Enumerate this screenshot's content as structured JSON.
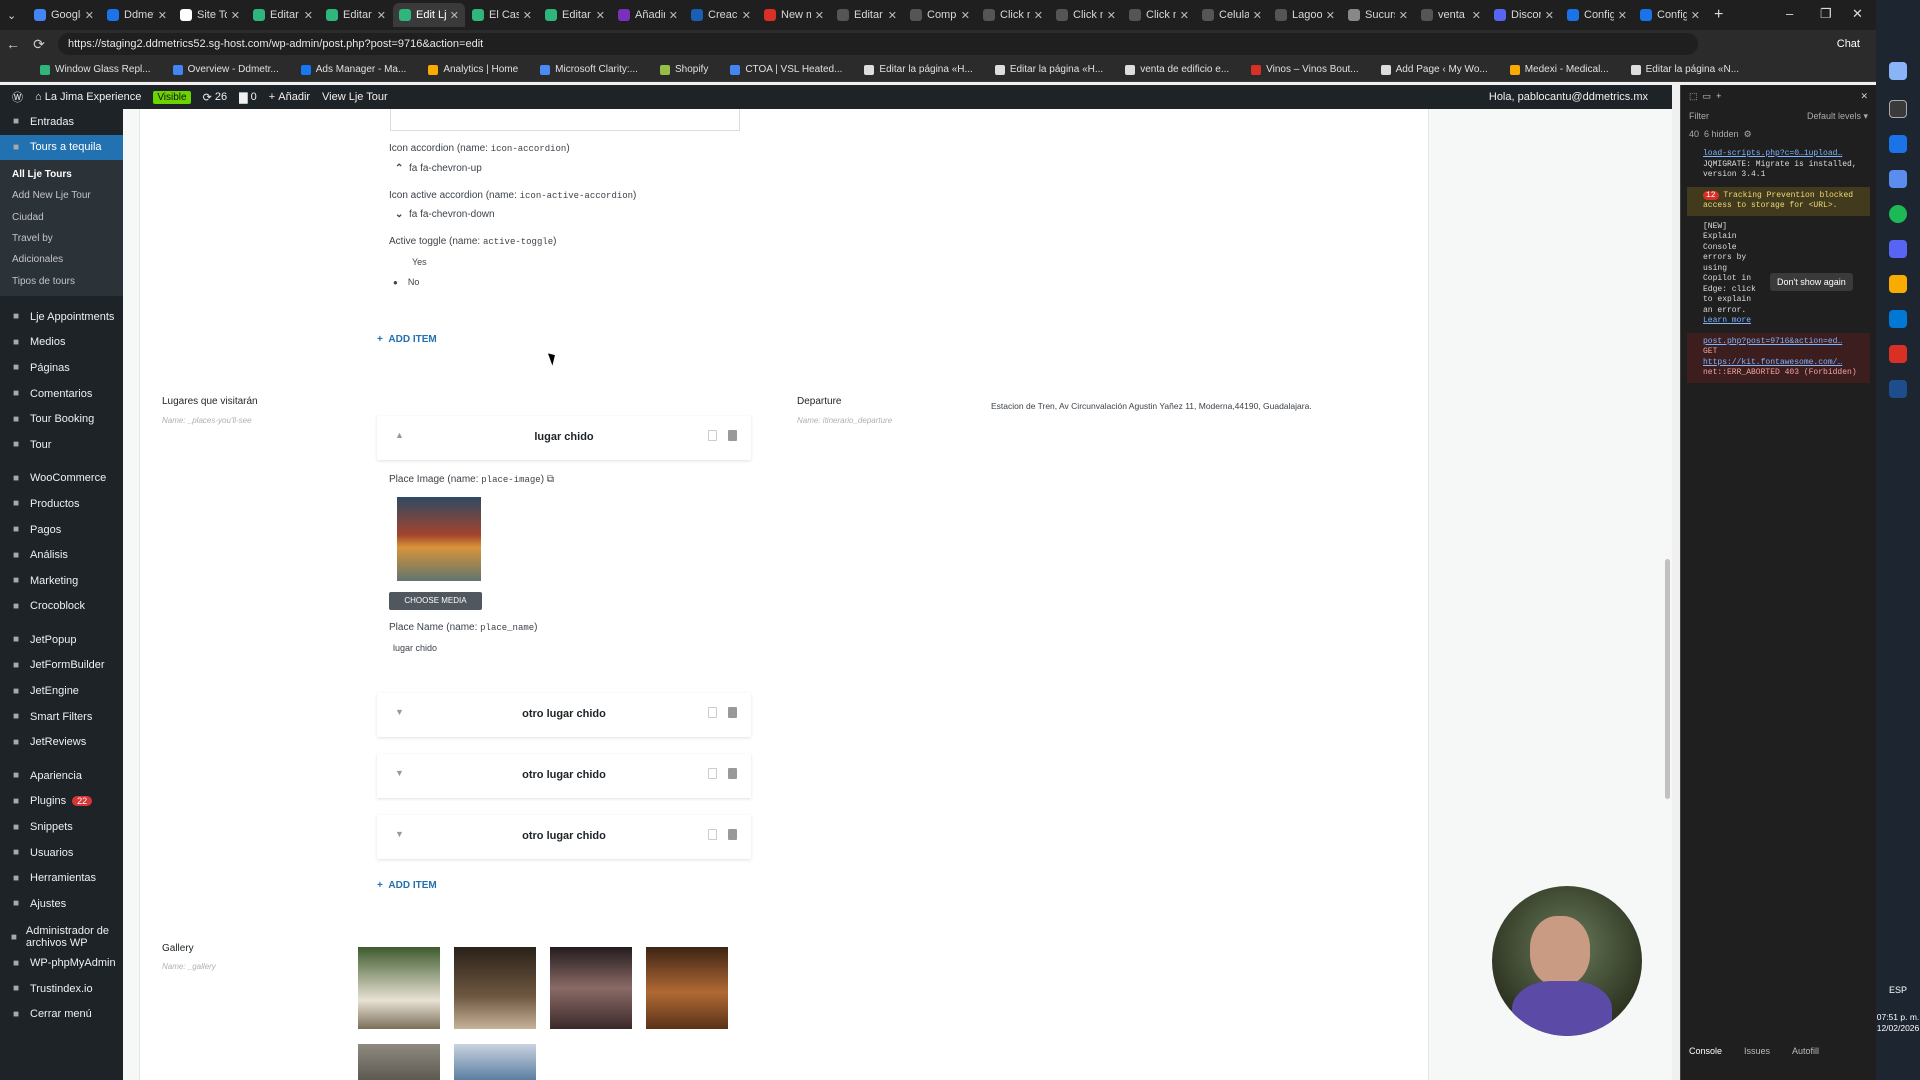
{
  "browser": {
    "tabs": [
      {
        "label": "Google",
        "color": "#4285f4"
      },
      {
        "label": "Ddmetr",
        "color": "#1a73e8"
      },
      {
        "label": "Site Tour",
        "color": "#ffffff"
      },
      {
        "label": "Editar e",
        "color": "#2eb67d"
      },
      {
        "label": "Editar e",
        "color": "#2eb67d"
      },
      {
        "label": "Edit Lje",
        "color": "#2eb67d",
        "active": true
      },
      {
        "label": "El Castil",
        "color": "#2eb67d"
      },
      {
        "label": "Editar e",
        "color": "#2eb67d"
      },
      {
        "label": "Añadir",
        "color": "#7b2fbf"
      },
      {
        "label": "Creació",
        "color": "#1a5fb4"
      },
      {
        "label": "New m",
        "color": "#d93025"
      },
      {
        "label": "Editar l",
        "color": "#555555"
      },
      {
        "label": "Compr",
        "color": "#555555"
      },
      {
        "label": "Click n",
        "color": "#555555"
      },
      {
        "label": "Click n",
        "color": "#555555"
      },
      {
        "label": "Click n",
        "color": "#555555"
      },
      {
        "label": "Celular",
        "color": "#555555"
      },
      {
        "label": "Lagoon",
        "color": "#555555"
      },
      {
        "label": "Sucurs",
        "color": "#888888"
      },
      {
        "label": "venta d",
        "color": "#555555"
      },
      {
        "label": "Discord",
        "color": "#5865f2"
      },
      {
        "label": "Config",
        "color": "#1a73e8"
      },
      {
        "label": "Config",
        "color": "#1a73e8"
      }
    ],
    "url": "https://staging2.ddmetrics52.sg-host.com/wp-admin/post.php?post=9716&action=edit",
    "chat_label": "Chat",
    "bookmarks": [
      {
        "label": "Window Glass Repl...",
        "color": "#2eb67d"
      },
      {
        "label": "Overview - Ddmetr...",
        "color": "#4285f4"
      },
      {
        "label": "Ads Manager - Ma...",
        "color": "#1877f2"
      },
      {
        "label": "Analytics | Home",
        "color": "#f9ab00"
      },
      {
        "label": "Microsoft Clarity:...",
        "color": "#4a8af4"
      },
      {
        "label": "Shopify",
        "color": "#95bf47"
      },
      {
        "label": "CTOA | VSL Heated...",
        "color": "#4285f4"
      },
      {
        "label": "Editar la página «H...",
        "color": "#dddddd"
      },
      {
        "label": "Editar la página «H...",
        "color": "#dddddd"
      },
      {
        "label": "venta de edificio e...",
        "color": "#dddddd"
      },
      {
        "label": "Vinos – Vinos Bout...",
        "color": "#d93025"
      },
      {
        "label": "Add Page ‹ My Wo...",
        "color": "#dddddd"
      },
      {
        "label": "Medexi - Medical...",
        "color": "#f9ab00"
      },
      {
        "label": "Editar la página «N...",
        "color": "#dddddd"
      }
    ]
  },
  "wpbar": {
    "site": "La Jima Experience",
    "visible": "Visible",
    "updates": "26",
    "comments": "0",
    "add": "Añadir",
    "view": "View Lje Tour",
    "howdy": "Hola, pablocantu@ddmetrics.mx"
  },
  "sidebar": {
    "top": [
      {
        "label": "Entradas",
        "icon": "pin-icon"
      },
      {
        "label": "Tours a tequila",
        "icon": "pin-icon",
        "current": true
      }
    ],
    "submenu": [
      "All Lje Tours",
      "Add New Lje Tour",
      "Ciudad",
      "Travel by",
      "Adicionales",
      "Tipos de tours"
    ],
    "group1": [
      {
        "label": "Lje Appointments"
      },
      {
        "label": "Medios"
      },
      {
        "label": "Páginas"
      },
      {
        "label": "Comentarios"
      },
      {
        "label": "Tour Booking"
      },
      {
        "label": "Tour"
      }
    ],
    "group2": [
      {
        "label": "WooCommerce"
      },
      {
        "label": "Productos"
      },
      {
        "label": "Pagos"
      },
      {
        "label": "Análisis"
      },
      {
        "label": "Marketing"
      },
      {
        "label": "Crocoblock"
      }
    ],
    "group3": [
      {
        "label": "JetPopup"
      },
      {
        "label": "JetFormBuilder"
      },
      {
        "label": "JetEngine"
      },
      {
        "label": "Smart Filters"
      },
      {
        "label": "JetReviews"
      }
    ],
    "group4": [
      {
        "label": "Apariencia"
      },
      {
        "label": "Plugins",
        "badge": "22"
      },
      {
        "label": "Snippets"
      },
      {
        "label": "Usuarios"
      },
      {
        "label": "Herramientas"
      },
      {
        "label": "Ajustes"
      }
    ],
    "group5": [
      {
        "label": "Administrador de archivos WP"
      },
      {
        "label": "WP-phpMyAdmin"
      },
      {
        "label": "Trustindex.io"
      },
      {
        "label": "Cerrar menú"
      }
    ]
  },
  "editor": {
    "icon_accordion_label": "Icon accordion (name: ",
    "icon_accordion_name": "icon-accordion",
    "icon_accordion_value": "fa fa-chevron-up",
    "icon_active_label": "Icon active accordion (name: ",
    "icon_active_name": "icon-active-accordion",
    "icon_active_value": "fa fa-chevron-down",
    "active_toggle_label": "Active toggle (name: ",
    "active_toggle_name": "active-toggle",
    "yes": "Yes",
    "no": "No",
    "add_item": "ADD ITEM",
    "places_title": "Lugares que visitarán",
    "places_name": "Name: _places-you'll-see",
    "departure_title": "Departure",
    "departure_name": "Name: itinerario_departure",
    "departure_value": "Estacion de Tren, Av Circunvalación Agustin Yañez 11, Moderna,44190, Guadalajara.",
    "repeater_items": [
      "lugar chido",
      "otro lugar chido",
      "otro lugar chido",
      "otro lugar chido"
    ],
    "place_image_label": "Place Image (name: ",
    "place_image_name": "place-image",
    "choose_media": "CHOOSE MEDIA",
    "place_name_label": "Place Name (name: ",
    "place_name_name": "place_name",
    "place_name_value": "lugar chido",
    "close_paren": ")",
    "gallery_title": "Gallery",
    "gallery_name": "Name: _gallery"
  },
  "devtools": {
    "filter": "Filter",
    "levels": "Default levels ▾",
    "count": "40",
    "hidden": "6 hidden",
    "msg1_link": "load-scripts.php?c=0…1upload…",
    "msg1": "JQMIGRATE: Migrate is installed, version 3.4.1",
    "msg2_badge": "12",
    "msg2": "Tracking Prevention blocked access to storage for <URL>.",
    "msg3": "[NEW] Explain Console errors by using Copilot in Edge: click  to explain an error.",
    "msg3_link": "Learn more",
    "dont_show": "Don't show again",
    "err_link": "post.php?post=9716&action=ed…",
    "err_get": "GET",
    "err_url": "https://kit.fontawesome.com/…",
    "err_text": "net::ERR_ABORTED 403 (Forbidden)",
    "tabs": [
      "Console",
      "Issues",
      "Autofill"
    ]
  },
  "taskbar": {
    "lang": "ESP",
    "time": "07:51 p. m.",
    "date": "12/02/2026"
  }
}
